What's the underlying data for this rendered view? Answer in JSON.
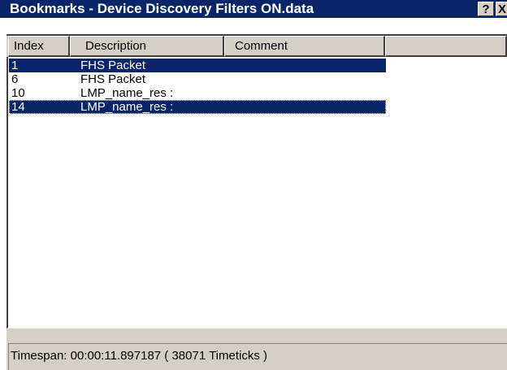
{
  "window": {
    "title": "Bookmarks - Device Discovery Filters ON.data",
    "help_label": "?",
    "close_label": "X"
  },
  "columns": [
    "Index",
    "Description",
    "Comment"
  ],
  "rows": [
    {
      "index": "1",
      "description": "FHS Packet",
      "comment": "",
      "selected": true
    },
    {
      "index": "6",
      "description": "FHS Packet",
      "comment": "",
      "selected": false
    },
    {
      "index": "10",
      "description": "LMP_name_res :",
      "comment": "",
      "selected": false
    },
    {
      "index": "14",
      "description": "LMP_name_res :",
      "comment": "",
      "selected": true
    }
  ],
  "status": {
    "timespan": "Timespan: 00:00:11.897187 ( 38071 Timeticks )"
  },
  "colors": {
    "selection": "#0a246a",
    "face": "#d4d0c8"
  }
}
